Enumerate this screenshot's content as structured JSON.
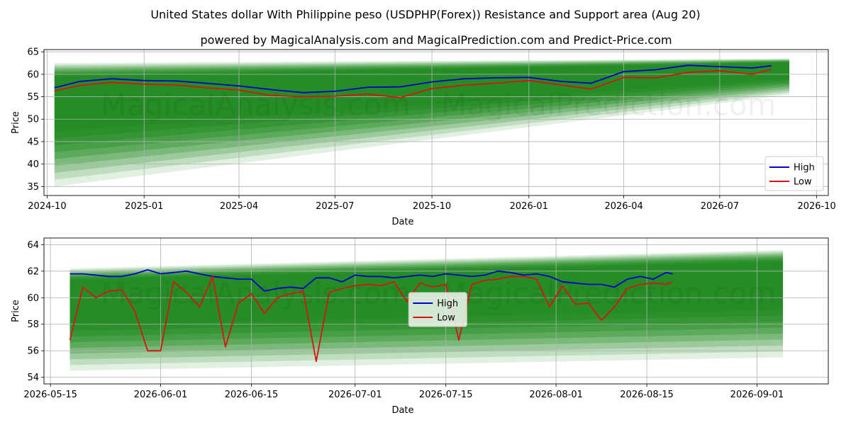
{
  "title": "United States dollar With Philippine peso (USDPHP(Forex)) Resistance and Support area (Aug 20)",
  "subtitle": "powered by MagicalAnalysis.com and MagicalPrediction.com and Predict-Price.com",
  "watermarks": [
    "MagicalAnalysis.com",
    "MagicalPrediction.com"
  ],
  "colors": {
    "high": "#0000cc",
    "low": "#dd1111",
    "band": "#1e8a1e"
  },
  "chart_data": [
    {
      "type": "line",
      "xlabel": "Date",
      "ylabel": "Price",
      "ylim": [
        33,
        65.5
      ],
      "xlim": [
        "2024-09-28",
        "2026-10-12"
      ],
      "yticks": [
        35,
        40,
        45,
        50,
        55,
        60,
        65
      ],
      "xticks": [
        "2024-10",
        "2025-01",
        "2025-04",
        "2025-07",
        "2025-10",
        "2026-01",
        "2026-04",
        "2026-07",
        "2026-10"
      ],
      "grid": true,
      "legend_position": "lower-right",
      "band": {
        "start": "2024-10-08",
        "end": "2026-09-05",
        "start_low": 35,
        "start_high": 62.5,
        "end_low": 55.5,
        "end_high": 63.5
      },
      "x": [
        "2024-10-08",
        "2024-11-01",
        "2024-12-01",
        "2025-01-01",
        "2025-02-01",
        "2025-03-01",
        "2025-04-01",
        "2025-05-01",
        "2025-06-01",
        "2025-07-01",
        "2025-08-01",
        "2025-09-01",
        "2025-10-01",
        "2025-11-01",
        "2025-12-01",
        "2026-01-01",
        "2026-02-01",
        "2026-03-01",
        "2026-04-01",
        "2026-05-01",
        "2026-06-01",
        "2026-07-01",
        "2026-08-01",
        "2026-08-19"
      ],
      "series": [
        {
          "name": "High",
          "values": [
            57.0,
            58.4,
            59.0,
            58.6,
            58.5,
            58.0,
            57.4,
            56.6,
            55.9,
            56.2,
            57.1,
            57.2,
            58.3,
            59.0,
            59.2,
            59.3,
            58.4,
            58.0,
            60.6,
            61.0,
            62.0,
            61.7,
            61.4,
            61.9
          ]
        },
        {
          "name": "Low",
          "values": [
            56.3,
            57.5,
            58.2,
            57.8,
            57.6,
            57.0,
            56.5,
            55.3,
            55.0,
            55.1,
            55.6,
            54.8,
            56.8,
            57.6,
            58.0,
            58.6,
            57.6,
            56.7,
            59.3,
            59.2,
            60.4,
            60.8,
            60.0,
            61.1
          ]
        }
      ]
    },
    {
      "type": "line",
      "xlabel": "Date",
      "ylabel": "Price",
      "ylim": [
        53.5,
        64.5
      ],
      "xlim": [
        "2026-05-14",
        "2026-09-12"
      ],
      "yticks": [
        54,
        56,
        58,
        60,
        62,
        64
      ],
      "xticks": [
        "2026-05-15",
        "2026-06-01",
        "2026-06-15",
        "2026-07-01",
        "2026-07-15",
        "2026-08-01",
        "2026-08-15",
        "2026-09-01"
      ],
      "grid": true,
      "legend_position": "center",
      "band": {
        "start": "2026-05-18",
        "end": "2026-09-05",
        "start_low": 54.5,
        "start_high": 62.2,
        "end_low": 55.5,
        "end_high": 63.6
      },
      "x": [
        "2026-05-18",
        "2026-05-20",
        "2026-05-22",
        "2026-05-24",
        "2026-05-26",
        "2026-05-28",
        "2026-05-30",
        "2026-06-01",
        "2026-06-03",
        "2026-06-05",
        "2026-06-07",
        "2026-06-09",
        "2026-06-11",
        "2026-06-13",
        "2026-06-15",
        "2026-06-17",
        "2026-06-19",
        "2026-06-21",
        "2026-06-23",
        "2026-06-25",
        "2026-06-27",
        "2026-06-29",
        "2026-07-01",
        "2026-07-03",
        "2026-07-05",
        "2026-07-07",
        "2026-07-09",
        "2026-07-11",
        "2026-07-13",
        "2026-07-15",
        "2026-07-17",
        "2026-07-19",
        "2026-07-21",
        "2026-07-23",
        "2026-07-25",
        "2026-07-27",
        "2026-07-29",
        "2026-07-31",
        "2026-08-02",
        "2026-08-04",
        "2026-08-06",
        "2026-08-08",
        "2026-08-10",
        "2026-08-12",
        "2026-08-14",
        "2026-08-16",
        "2026-08-18",
        "2026-08-19"
      ],
      "series": [
        {
          "name": "High",
          "values": [
            61.8,
            61.8,
            61.7,
            61.6,
            61.6,
            61.8,
            62.1,
            61.8,
            61.9,
            62.0,
            61.8,
            61.6,
            61.5,
            61.4,
            61.4,
            60.5,
            60.7,
            60.8,
            60.7,
            61.5,
            61.5,
            61.2,
            61.7,
            61.6,
            61.6,
            61.5,
            61.6,
            61.7,
            61.6,
            61.8,
            61.7,
            61.6,
            61.7,
            62.0,
            61.9,
            61.7,
            61.8,
            61.6,
            61.2,
            61.1,
            61.0,
            61.0,
            60.8,
            61.4,
            61.6,
            61.4,
            61.9,
            61.8
          ]
        },
        {
          "name": "Low",
          "values": [
            56.8,
            60.8,
            60.0,
            60.5,
            60.6,
            59.0,
            56.0,
            56.0,
            61.2,
            60.4,
            59.3,
            61.6,
            56.3,
            59.6,
            60.3,
            58.8,
            60.0,
            60.3,
            60.5,
            55.2,
            60.4,
            60.7,
            60.9,
            61.0,
            60.9,
            61.2,
            59.7,
            61.1,
            60.8,
            61.0,
            56.8,
            61.0,
            61.3,
            61.4,
            61.6,
            61.6,
            61.4,
            59.3,
            60.9,
            59.5,
            59.6,
            58.3,
            59.3,
            60.7,
            61.0,
            61.1,
            61.0,
            61.2
          ]
        }
      ]
    }
  ]
}
